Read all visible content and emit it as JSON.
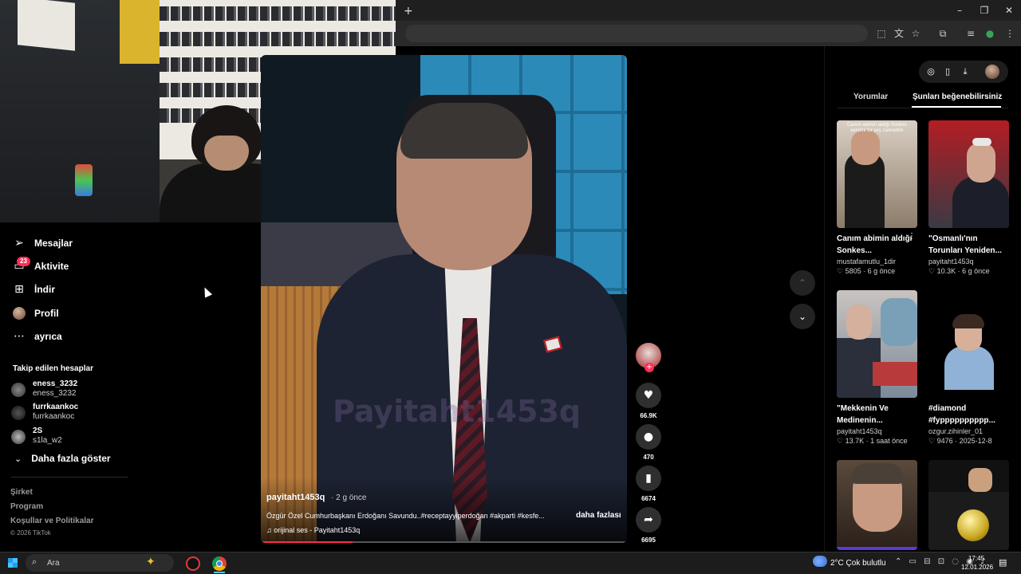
{
  "browser": {
    "new_tab_icon": "plus-icon",
    "window_controls": [
      "minimize",
      "restore",
      "close"
    ],
    "toolbar_icons": [
      "screenshot-icon",
      "translate-icon",
      "star-icon",
      "extensions-icon",
      "playlist-icon",
      "profile-icon",
      "menu-icon"
    ]
  },
  "sidebar": {
    "items": [
      {
        "label": "Mesajlar",
        "icon": "paper-plane-icon"
      },
      {
        "label": "Aktivite",
        "icon": "inbox-icon",
        "badge": "23"
      },
      {
        "label": "İndir",
        "icon": "download-box-icon"
      },
      {
        "label": "Profil",
        "icon": "avatar"
      },
      {
        "label": "ayrıca",
        "icon": "more-dots-icon"
      }
    ],
    "following_heading": "Takip edilen hesaplar",
    "accounts": [
      {
        "name": "eness_3232",
        "handle": "eness_3232"
      },
      {
        "name": "furrkaankoc",
        "handle": "furrkaankoc"
      },
      {
        "name": "2S",
        "handle": "s1la_w2"
      }
    ],
    "show_more": "Daha fazla göster",
    "footer": [
      "Şirket",
      "Program",
      "Koşullar ve Politikalar"
    ],
    "copyright": "© 2026 TikTok"
  },
  "video": {
    "watermark": "Payitaht1453q",
    "author": "payitaht1453q",
    "time_ago": "· 2 g önce",
    "description": "Özgür Özel Cumhurbaşkanı Erdoğanı Savundu..#receptayyiperdoğan #akparti #kesfe...",
    "more_label": "daha fazlası",
    "music": "♫  orijinal ses - Payitaht1453q",
    "progress": 0.25
  },
  "actions": {
    "likes": "66.9K",
    "comments": "470",
    "saves": "6674",
    "shares": "6695"
  },
  "right_panel": {
    "tabs": [
      "Yorumlar",
      "Şunları beğenebilirsiniz"
    ],
    "active_tab": 1,
    "cards": [
      {
        "title": "Canım abimin aldığı Sonkes...",
        "author": "mustafamutlu_1dir",
        "stats": "♡ 5805 · 6 g önce",
        "overlay": "Canım abimin aldığı Sonkes kendini bir şey zannettim"
      },
      {
        "title": "\"Osmanlı'nın Torunları Yeniden...",
        "author": "payitaht1453q",
        "stats": "♡ 10.3K · 6 g önce"
      },
      {
        "title": "\"Mekkenin Ve Medinenin...",
        "author": "payitaht1453q",
        "stats": "♡ 13.7K · 1 saat önce"
      },
      {
        "title": "#diamond #fypppppppppp...",
        "author": "ozgur.zihinler_01",
        "stats": "♡ 9476 · 2025-12-8"
      },
      {
        "title": "",
        "author": "",
        "stats": ""
      },
      {
        "title": "",
        "author": "",
        "stats": ""
      }
    ]
  },
  "taskbar": {
    "search_placeholder": "Ara",
    "weather": "2°C  Çok bulutlu",
    "time": "17:45",
    "date": "12.01.2026"
  }
}
